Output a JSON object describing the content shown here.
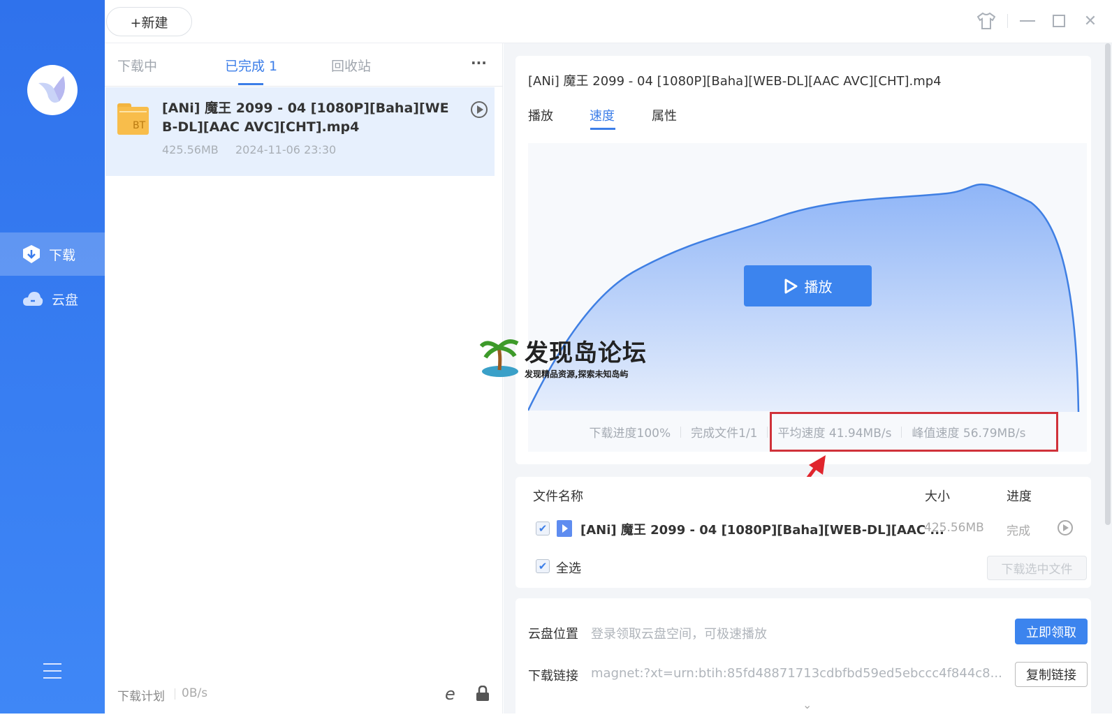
{
  "sidebar": {
    "items": [
      {
        "label": "下载",
        "icon": "download-shield-icon",
        "active": true
      },
      {
        "label": "云盘",
        "icon": "cloud-icon"
      }
    ],
    "menu_icon": "hamburger-icon"
  },
  "toolbar": {
    "new_label": "+新建",
    "controls": [
      "skin-icon",
      "minimize-icon",
      "maximize-icon",
      "close-icon"
    ]
  },
  "list": {
    "tabs": [
      {
        "label": "下载中"
      },
      {
        "label": "已完成 1",
        "active": true
      },
      {
        "label": "回收站"
      }
    ],
    "more": "···",
    "items": [
      {
        "name": "[ANi] 魔王 2099 - 04 [1080P][Baha][WEB-DL][AAC AVC][CHT].mp4",
        "badge": "BT",
        "size": "425.56MB",
        "date": "2024-11-06 23:30"
      }
    ],
    "footer": {
      "plan_label": "下载计划",
      "speed": "0B/s"
    }
  },
  "detail": {
    "title": "[ANi] 魔王 2099 - 04 [1080P][Baha][WEB-DL][AAC AVC][CHT].mp4",
    "tabs": [
      {
        "label": "播放"
      },
      {
        "label": "速度",
        "active": true
      },
      {
        "label": "属性"
      }
    ],
    "play_label": "播放",
    "stats": {
      "progress": "下载进度100%",
      "files": "完成文件1/1",
      "avg": "平均速度 41.94MB/s",
      "peak": "峰值速度 56.79MB/s"
    },
    "accent": "#3c84ee",
    "files": {
      "headers": {
        "name": "文件名称",
        "size": "大小",
        "progress": "进度"
      },
      "rows": [
        {
          "name": "[ANi] 魔王 2099 - 04 [1080P][Baha][WEB-DL][AAC ...",
          "size": "425.56MB",
          "status": "完成",
          "checked": true
        }
      ],
      "select_all": "全选",
      "download_selected": "下载选中文件"
    },
    "cloud": {
      "label": "云盘位置",
      "hint": "登录领取云盘空间，可极速播放",
      "button": "立即领取"
    },
    "link": {
      "label": "下载链接",
      "value": "magnet:?xt=urn:btih:85fd48871713cdbfbd59ed5ebccc4f844c8...",
      "button": "复制链接"
    }
  },
  "watermark": {
    "title": "发现岛论坛",
    "subtitle": "发现精品资源,探索未知岛屿"
  }
}
